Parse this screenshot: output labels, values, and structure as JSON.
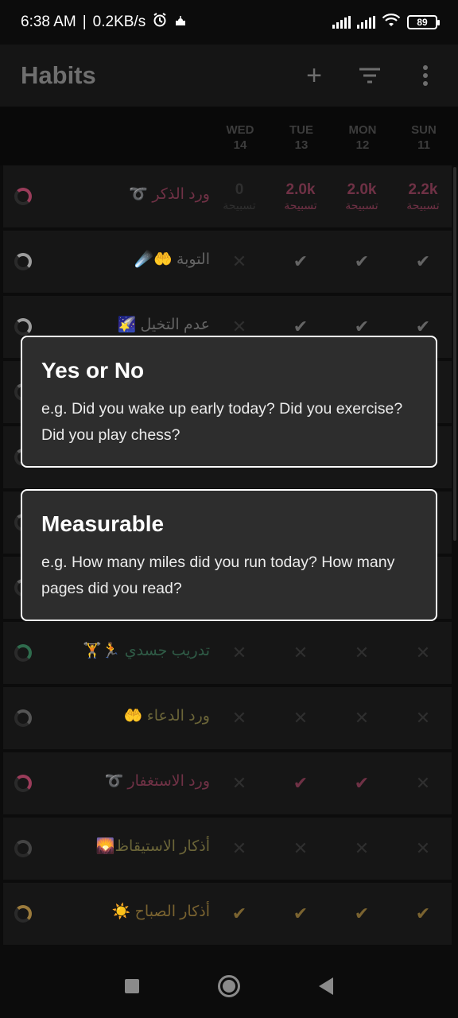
{
  "status_bar": {
    "time": "6:38 AM",
    "separator": "|",
    "speed": "0.2KB/s",
    "battery": "89",
    "icons": [
      "alarm-icon",
      "mosque-icon",
      "signal-icon",
      "signal-icon",
      "wifi-icon",
      "battery-icon"
    ]
  },
  "app_bar": {
    "title": "Habits",
    "add_icon": "+",
    "filter_icon": "filter-icon",
    "menu_icon": "more-vert-icon"
  },
  "days": [
    {
      "name": "WED",
      "num": "14"
    },
    {
      "name": "TUE",
      "num": "13"
    },
    {
      "name": "MON",
      "num": "12"
    },
    {
      "name": "SUN",
      "num": "11"
    }
  ],
  "habits": [
    {
      "name": "ورد الذكر ➰",
      "color": "#6f3145",
      "ring": "#9a3c5a",
      "cells": [
        {
          "v": "0",
          "u": "تسبيحة",
          "dim": true
        },
        {
          "v": "2.0k",
          "u": "تسبيحة"
        },
        {
          "v": "2.0k",
          "u": "تسبيحة"
        },
        {
          "v": "2.2k",
          "u": "تسبيحة"
        }
      ]
    },
    {
      "name": "التوبة 🤲☄️",
      "color": "#646464",
      "ring": "#9c9c9c",
      "cells": [
        {
          "mark": "✕",
          "dim": true
        },
        {
          "mark": "✔"
        },
        {
          "mark": "✔"
        },
        {
          "mark": "✔"
        }
      ]
    },
    {
      "name": "عدم التخيل 🌠",
      "color": "#646464",
      "ring": "#9c9c9c",
      "cells": [
        {
          "mark": "✕",
          "dim": true
        },
        {
          "mark": "✔"
        },
        {
          "mark": "✔"
        },
        {
          "mark": "✔"
        }
      ]
    },
    {
      "name": "",
      "color": "#646464",
      "ring": "#5a5a5a",
      "cells": []
    },
    {
      "name": "",
      "color": "#646464",
      "ring": "#5a5a5a",
      "cells": []
    },
    {
      "name": "",
      "color": "#646464",
      "ring": "#5a5a5a",
      "cells": []
    },
    {
      "name": "",
      "color": "#646464",
      "ring": "#5a5a5a",
      "cells": []
    },
    {
      "name": "تدريب جسدي 🏃🏋️",
      "color": "#2f5b46",
      "ring": "#2f6b4d",
      "cells": [
        {
          "mark": "✕",
          "dim": true
        },
        {
          "mark": "✕",
          "dim": true
        },
        {
          "mark": "✕",
          "dim": true
        },
        {
          "mark": "✕",
          "dim": true
        }
      ]
    },
    {
      "name": "ورد الدعاء 🤲",
      "color": "#6b6538",
      "ring": "#555555",
      "cells": [
        {
          "mark": "✕",
          "dim": true
        },
        {
          "mark": "✕",
          "dim": true
        },
        {
          "mark": "✕",
          "dim": true
        },
        {
          "mark": "✕",
          "dim": true
        }
      ]
    },
    {
      "name": "ورد الاستغفار ➰",
      "color": "#6f3145",
      "ring": "#9a3c5a",
      "cells": [
        {
          "mark": "✕",
          "dim": true
        },
        {
          "mark": "✔"
        },
        {
          "mark": "✔"
        },
        {
          "mark": "✕",
          "dim": true
        }
      ]
    },
    {
      "name": "أذكار الاستيقاظ🌄",
      "color": "#6b6538",
      "ring": "#444444",
      "cells": [
        {
          "mark": "✕",
          "dim": true
        },
        {
          "mark": "✕",
          "dim": true
        },
        {
          "mark": "✕",
          "dim": true
        },
        {
          "mark": "✕",
          "dim": true
        }
      ]
    },
    {
      "name": "أذكار الصباح ☀️",
      "color": "#7a6330",
      "ring": "#9a7a3c",
      "cells": [
        {
          "mark": "✔"
        },
        {
          "mark": "✔"
        },
        {
          "mark": "✔"
        },
        {
          "mark": "✔"
        }
      ]
    }
  ],
  "dialog": {
    "options": [
      {
        "title": "Yes or No",
        "description": "e.g. Did you wake up early today? Did you exercise? Did you play chess?"
      },
      {
        "title": "Measurable",
        "description": "e.g. How many miles did you run today? How many pages did you read?"
      }
    ]
  },
  "nav_bar": {
    "icons": [
      "recents-square-icon",
      "home-circle-icon",
      "back-triangle-icon"
    ]
  }
}
